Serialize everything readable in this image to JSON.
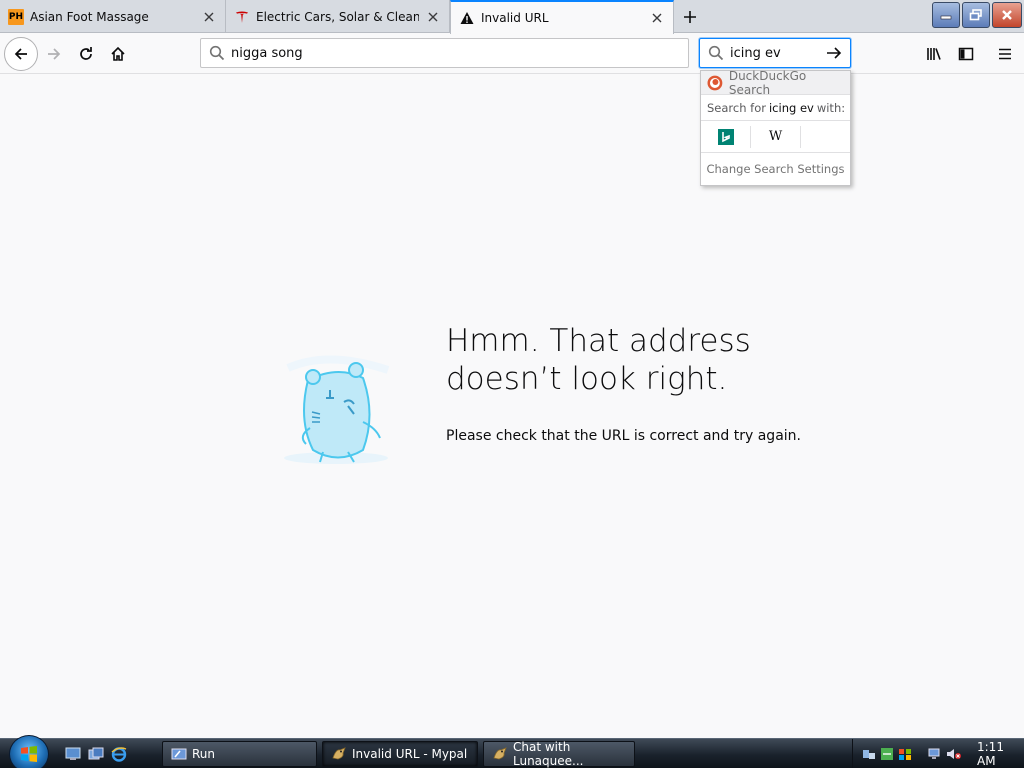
{
  "tabs": [
    {
      "title": "Asian Foot Massage",
      "icon": "ph-icon",
      "icon_text": "PH"
    },
    {
      "title": "Electric Cars, Solar & Clean Energy",
      "icon": "tesla-icon"
    },
    {
      "title": "Invalid URL",
      "icon": "warning-icon",
      "active": true
    }
  ],
  "navbar": {
    "url_value": "nigga song",
    "search_value": "icing ev"
  },
  "search_popup": {
    "engine_label": "DuckDuckGo Search",
    "search_for_prefix": "Search for",
    "search_for_term": "icing ev",
    "search_for_suffix": "with:",
    "engines": [
      "bing-icon",
      "wikipedia-icon"
    ],
    "wiki_letter": "W",
    "settings_label": "Change Search Settings"
  },
  "error_page": {
    "title": "Hmm. That address doesn’t look right.",
    "description": "Please check that the URL is correct and try again."
  },
  "taskbar": {
    "tasks": [
      {
        "label": "Run",
        "icon": "run-icon"
      },
      {
        "label": "Invalid URL - Mypal",
        "icon": "mypal-icon",
        "active": true
      },
      {
        "label": "Chat with Lunaquee...",
        "icon": "chat-icon"
      }
    ],
    "clock": "1:11 AM"
  },
  "colors": {
    "accent": "#0a84ff",
    "page_bg": "#f9f9fa",
    "tesla_red": "#cc0000"
  }
}
